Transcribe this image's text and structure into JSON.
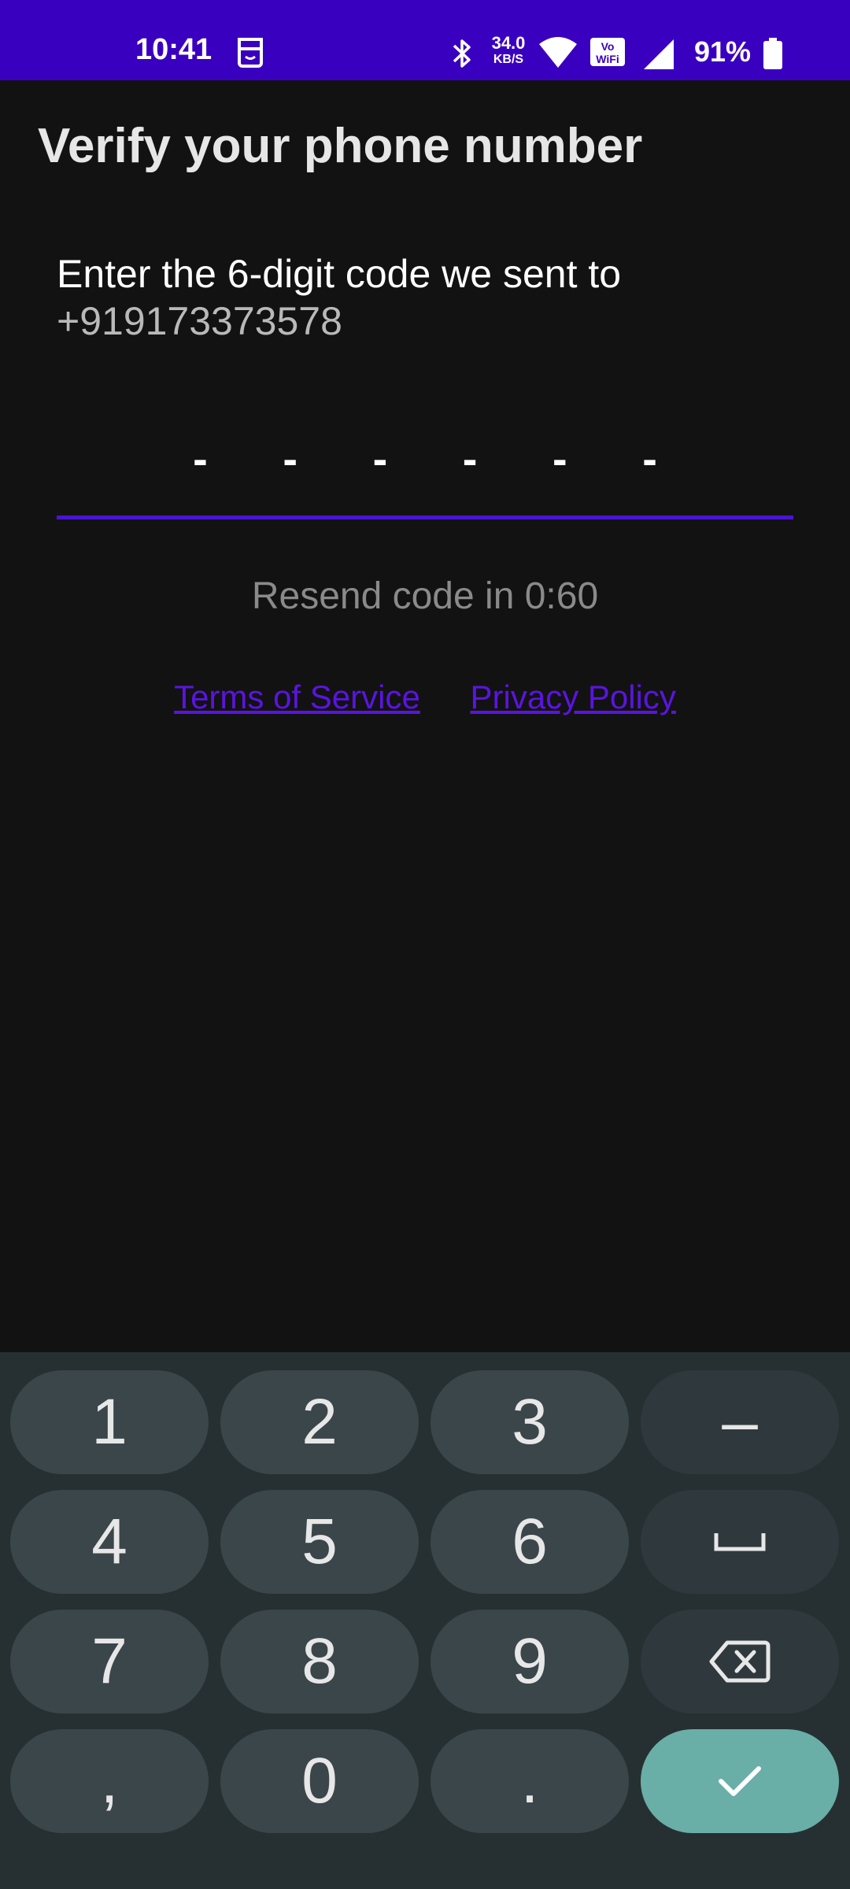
{
  "status_bar": {
    "time": "10:41",
    "net_speed_value": "34.0",
    "net_speed_unit": "KB/S",
    "battery": "91%",
    "icons": [
      "face-icon",
      "bluetooth-icon",
      "wifi-icon",
      "vowifi-icon",
      "signal-icon",
      "battery-icon"
    ],
    "background": "#3a00c0"
  },
  "title": "Verify your phone number",
  "instruction": {
    "text": "Enter the 6-digit code we sent to",
    "phone": "+919173373578"
  },
  "code_input": {
    "placeholder": "- - - - - -",
    "underline_color": "#4a14d6"
  },
  "resend_text": "Resend code in 0:60",
  "links": {
    "terms": "Terms of Service",
    "privacy": "Privacy Policy",
    "color": "#5a14e0"
  },
  "keyboard": {
    "keys": [
      "1",
      "2",
      "3",
      "–",
      "4",
      "5",
      "6",
      "7",
      "8",
      "9",
      ",",
      "0",
      "."
    ],
    "special_icons": [
      "space-icon",
      "backspace-icon",
      "checkmark-icon"
    ],
    "enter_color": "#6aaea8"
  }
}
